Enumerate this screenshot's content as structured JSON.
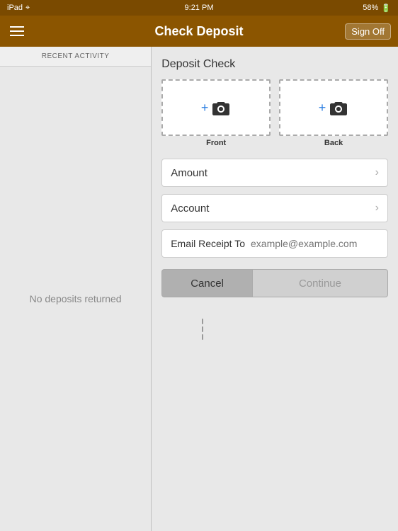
{
  "statusBar": {
    "device": "iPad",
    "wifi": "wifi-icon",
    "time": "9:21 PM",
    "battery_pct": "58%",
    "battery_icon": "battery-icon"
  },
  "navBar": {
    "title": "Check Deposit",
    "menu_icon": "menu-icon",
    "signoff_label": "Sign Off"
  },
  "sidebar": {
    "header": "RECENT ACTIVITY",
    "empty_text": "No deposits returned"
  },
  "rightPanel": {
    "section_title": "Deposit Check",
    "front_label": "Front",
    "back_label": "Back",
    "amount_label": "Amount",
    "account_label": "Account",
    "email_receipt_label": "Email Receipt To",
    "email_placeholder": "example@example.com",
    "cancel_label": "Cancel",
    "continue_label": "Continue"
  }
}
